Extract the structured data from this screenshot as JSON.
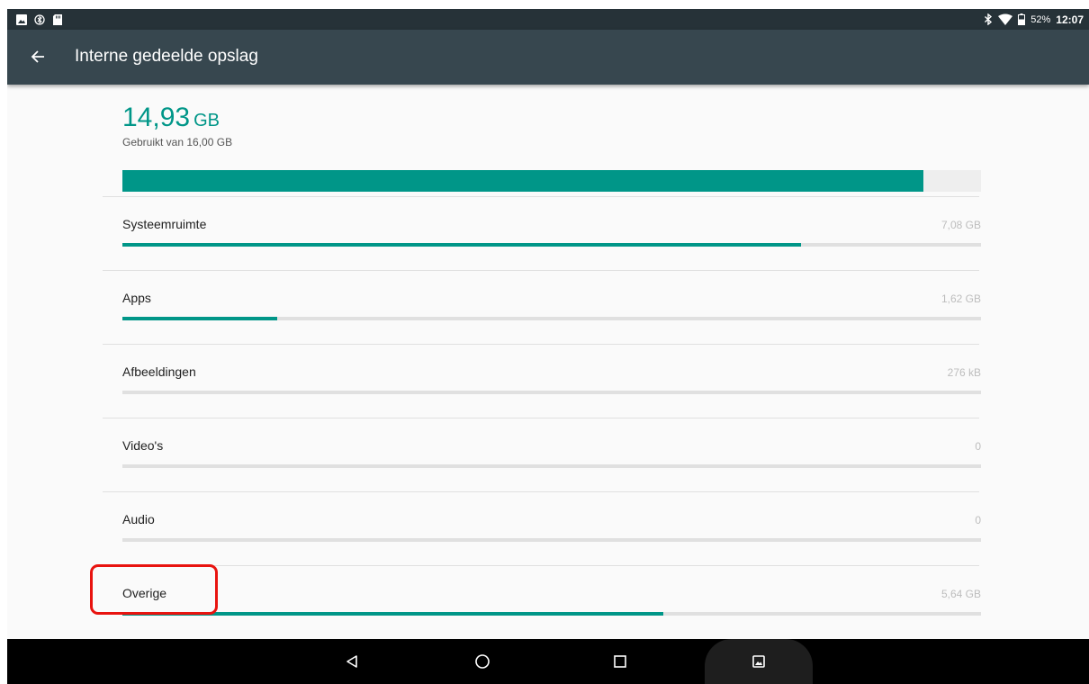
{
  "status_bar": {
    "battery": "52%",
    "time": "12:07",
    "left_icons": [
      "image-icon",
      "bluetooth-mark-icon",
      "sd-card-icon"
    ],
    "right_icons": [
      "bluetooth-icon",
      "wifi-icon",
      "battery-icon"
    ]
  },
  "toolbar": {
    "title": "Interne gedeelde opslag",
    "back_icon": "arrow-back-icon"
  },
  "storage": {
    "used_value": "14,93",
    "used_unit": "GB",
    "used_subtitle": "Gebruikt van 16,00 GB",
    "used_fraction": 0.933
  },
  "categories": [
    {
      "label": "Systeemruimte",
      "size": "7,08 GB",
      "fraction": 0.79
    },
    {
      "label": "Apps",
      "size": "1,62 GB",
      "fraction": 0.18
    },
    {
      "label": "Afbeeldingen",
      "size": "276 kB",
      "fraction": 0.0
    },
    {
      "label": "Video's",
      "size": "0",
      "fraction": 0.0
    },
    {
      "label": "Audio",
      "size": "0",
      "fraction": 0.0
    },
    {
      "label": "Overige",
      "size": "5,64 GB",
      "fraction": 0.63
    }
  ],
  "nav_bar": {
    "buttons": [
      "back-icon",
      "home-icon",
      "recents-icon",
      "screenshot-icon"
    ]
  },
  "colors": {
    "accent": "#009688",
    "toolbar": "#37474f",
    "status_bar": "#263238",
    "highlight": "#e8130f"
  }
}
